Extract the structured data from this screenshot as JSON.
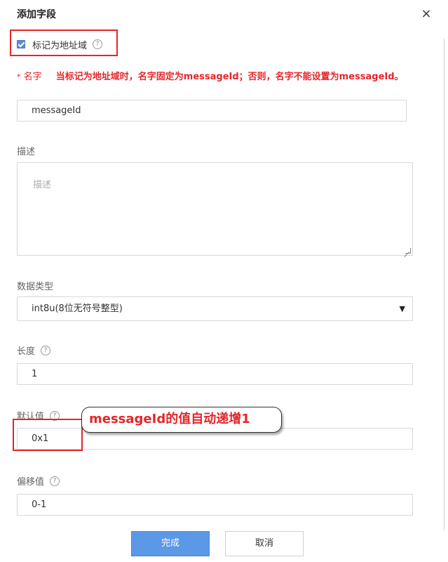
{
  "dialog": {
    "title": "添加字段",
    "close_glyph": "×"
  },
  "mark_address": {
    "checked": true,
    "label": "标记为地址域",
    "help_glyph": "?"
  },
  "name_field": {
    "required_mark": "*",
    "label": "名字",
    "warning": "当标记为地址域时，名字固定为messageId；否则，名字不能设置为messageId。",
    "value": "messageId"
  },
  "description": {
    "label": "描述",
    "placeholder": "描述"
  },
  "data_type": {
    "label": "数据类型",
    "selected": "int8u(8位无符号整型)",
    "arrow_glyph": "▼"
  },
  "length": {
    "label": "长度",
    "help_glyph": "?",
    "value": "1"
  },
  "default_value": {
    "label": "默认值",
    "help_glyph": "?",
    "value": "0x1"
  },
  "annotation": {
    "text": "messageId的值自动递增1"
  },
  "offset": {
    "label": "偏移值",
    "help_glyph": "?",
    "value": "0-1"
  },
  "buttons": {
    "confirm": "完成",
    "cancel": "取消"
  },
  "colors": {
    "accent_blue": "#5b98e6",
    "highlight_red": "#e4262a",
    "checkbox_blue": "#5b8dd6"
  }
}
